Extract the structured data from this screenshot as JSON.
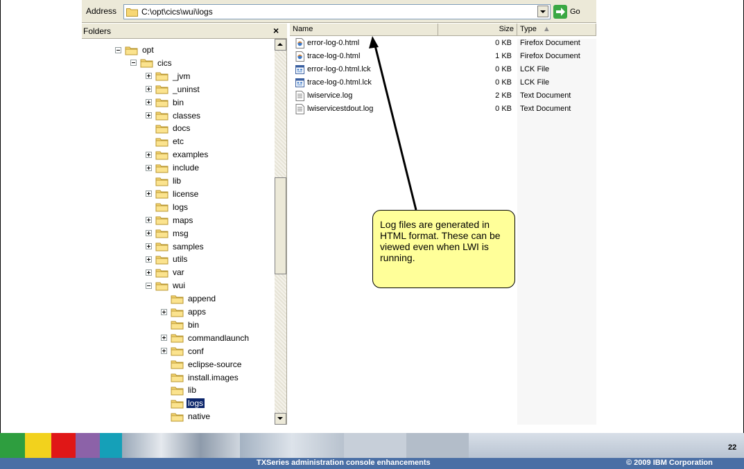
{
  "address_bar": {
    "label": "Address",
    "value": "C:\\opt\\cics\\wui\\logs",
    "go_label": "Go"
  },
  "folders_pane": {
    "title": "Folders",
    "close": "×",
    "tree": [
      {
        "label": "opt",
        "level": 0,
        "expander": "minus"
      },
      {
        "label": "cics",
        "level": 1,
        "expander": "minus"
      },
      {
        "label": "_jvm",
        "level": 2,
        "expander": "plus"
      },
      {
        "label": "_uninst",
        "level": 2,
        "expander": "plus"
      },
      {
        "label": "bin",
        "level": 2,
        "expander": "plus"
      },
      {
        "label": "classes",
        "level": 2,
        "expander": "plus"
      },
      {
        "label": "docs",
        "level": 2,
        "expander": "none"
      },
      {
        "label": "etc",
        "level": 2,
        "expander": "none"
      },
      {
        "label": "examples",
        "level": 2,
        "expander": "plus"
      },
      {
        "label": "include",
        "level": 2,
        "expander": "plus"
      },
      {
        "label": "lib",
        "level": 2,
        "expander": "none"
      },
      {
        "label": "license",
        "level": 2,
        "expander": "plus"
      },
      {
        "label": "logs",
        "level": 2,
        "expander": "none"
      },
      {
        "label": "maps",
        "level": 2,
        "expander": "plus"
      },
      {
        "label": "msg",
        "level": 2,
        "expander": "plus"
      },
      {
        "label": "samples",
        "level": 2,
        "expander": "plus"
      },
      {
        "label": "utils",
        "level": 2,
        "expander": "plus"
      },
      {
        "label": "var",
        "level": 2,
        "expander": "plus"
      },
      {
        "label": "wui",
        "level": 2,
        "expander": "minus"
      },
      {
        "label": "append",
        "level": 3,
        "expander": "none"
      },
      {
        "label": "apps",
        "level": 3,
        "expander": "plus"
      },
      {
        "label": "bin",
        "level": 3,
        "expander": "none"
      },
      {
        "label": "commandlaunch",
        "level": 3,
        "expander": "plus"
      },
      {
        "label": "conf",
        "level": 3,
        "expander": "plus"
      },
      {
        "label": "eclipse-source",
        "level": 3,
        "expander": "none"
      },
      {
        "label": "install.images",
        "level": 3,
        "expander": "none"
      },
      {
        "label": "lib",
        "level": 3,
        "expander": "none"
      },
      {
        "label": "logs",
        "level": 3,
        "expander": "none",
        "selected": true
      },
      {
        "label": "native",
        "level": 3,
        "expander": "none"
      }
    ]
  },
  "file_list": {
    "columns": {
      "name": "Name",
      "size": "Size",
      "type": "Type"
    },
    "files": [
      {
        "name": "error-log-0.html",
        "size": "0 KB",
        "type": "Firefox Document",
        "icon": "html-file-icon"
      },
      {
        "name": "trace-log-0.html",
        "size": "1 KB",
        "type": "Firefox Document",
        "icon": "html-file-icon"
      },
      {
        "name": "error-log-0.html.lck",
        "size": "0 KB",
        "type": "LCK File",
        "icon": "lck-file-icon"
      },
      {
        "name": "trace-log-0.html.lck",
        "size": "0 KB",
        "type": "LCK File",
        "icon": "lck-file-icon"
      },
      {
        "name": "lwiservice.log",
        "size": "2 KB",
        "type": "Text Document",
        "icon": "text-file-icon"
      },
      {
        "name": "lwiservicestdout.log",
        "size": "0 KB",
        "type": "Text Document",
        "icon": "text-file-icon"
      }
    ]
  },
  "callout": {
    "text": "Log files are generated in HTML format. These can be viewed even when LWI is running."
  },
  "footer": {
    "title": "TXSeries administration console enhancements",
    "copyright": "© 2009 IBM Corporation",
    "page_number": "22"
  },
  "colors": {
    "callout_fill": "#ffff99",
    "footer_bar": "#4a6fa5",
    "selection": "#0a246a"
  }
}
